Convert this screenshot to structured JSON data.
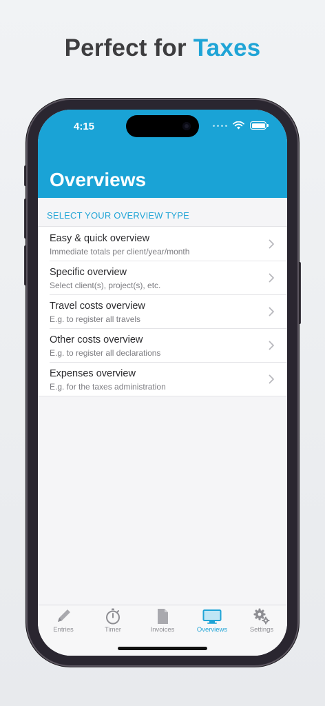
{
  "headline": {
    "prefix": "Perfect for",
    "accent": "Taxes"
  },
  "status_bar": {
    "time": "4:15"
  },
  "nav": {
    "title": "Overviews"
  },
  "section": {
    "header": "SELECT YOUR OVERVIEW TYPE"
  },
  "items": [
    {
      "title": "Easy & quick overview",
      "subtitle": "Immediate totals per client/year/month"
    },
    {
      "title": "Specific overview",
      "subtitle": "Select client(s), project(s), etc."
    },
    {
      "title": "Travel costs overview",
      "subtitle": "E.g. to register all travels"
    },
    {
      "title": "Other costs overview",
      "subtitle": "E.g. to register all declarations"
    },
    {
      "title": "Expenses overview",
      "subtitle": "E.g. for the taxes administration"
    }
  ],
  "tabs": [
    {
      "label": "Entries",
      "icon": "pencil-icon"
    },
    {
      "label": "Timer",
      "icon": "stopwatch-icon"
    },
    {
      "label": "Invoices",
      "icon": "document-icon"
    },
    {
      "label": "Overviews",
      "icon": "monitor-icon",
      "active": true
    },
    {
      "label": "Settings",
      "icon": "gears-icon"
    }
  ],
  "colors": {
    "accent": "#1fa4d6",
    "app_bar": "#1aa3d6",
    "headline": "#3d3d3f"
  }
}
